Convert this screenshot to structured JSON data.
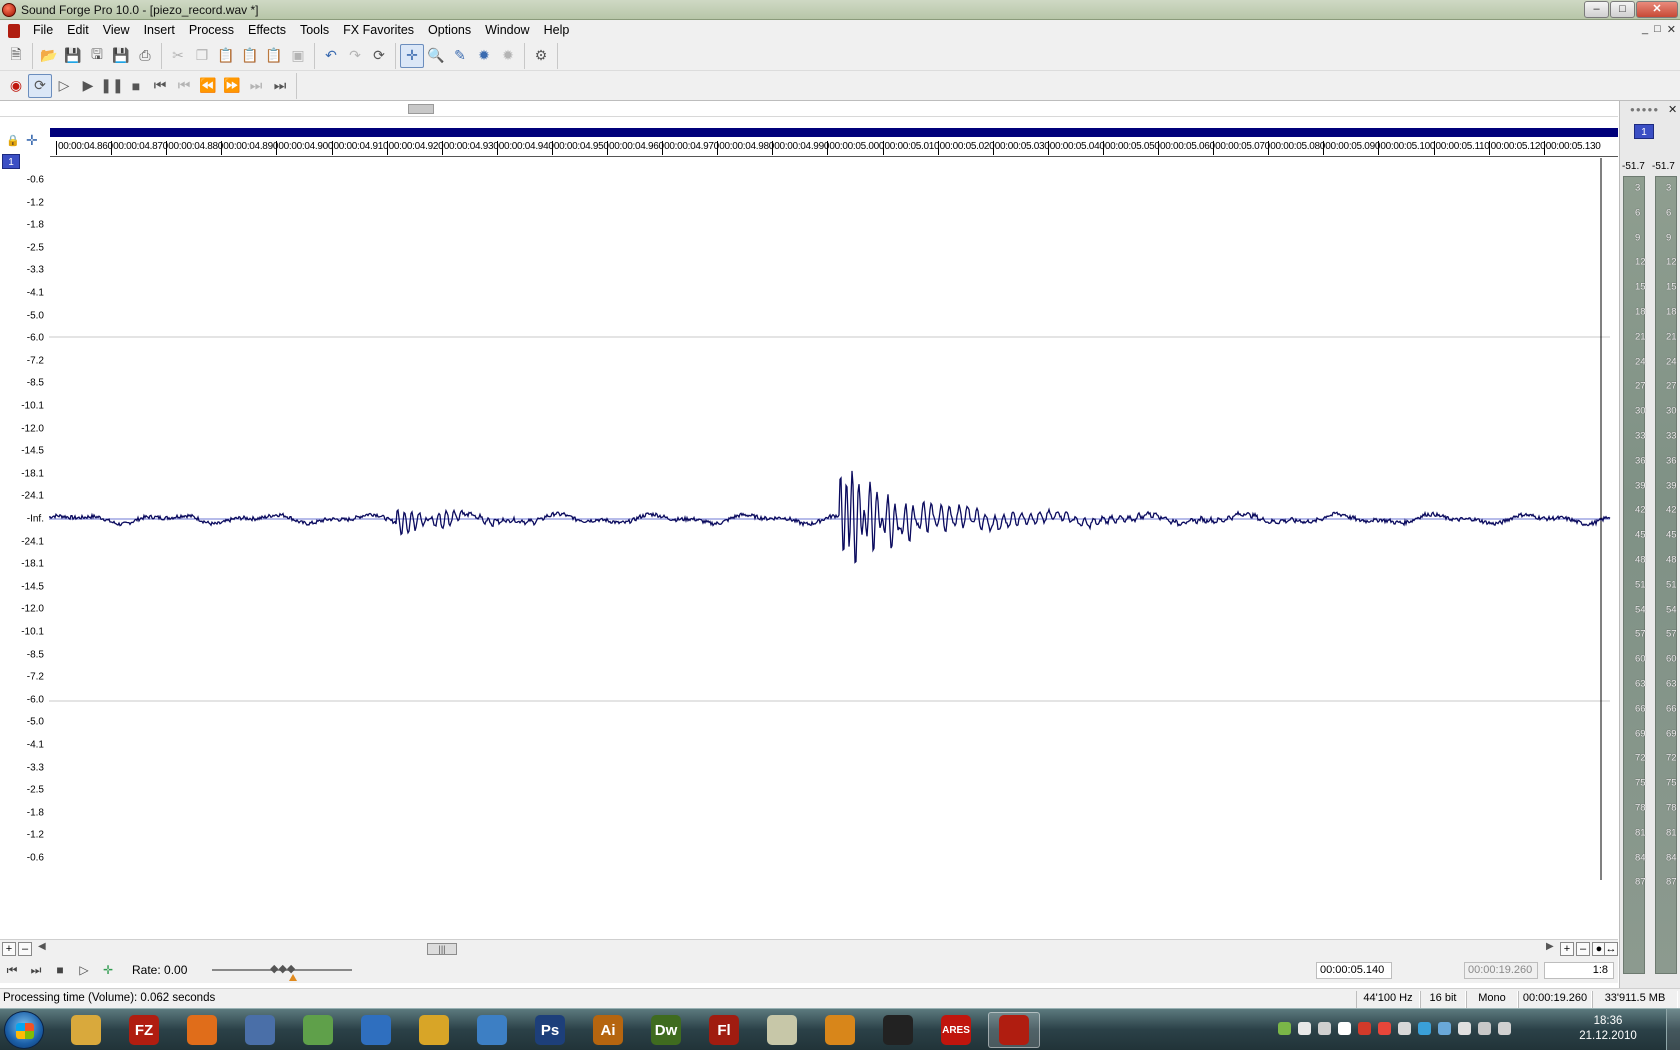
{
  "window": {
    "title": "Sound Forge Pro 10.0 - [piezo_record.wav *]",
    "controls": [
      "–",
      "□",
      "✕"
    ]
  },
  "menu": {
    "items": [
      "File",
      "Edit",
      "View",
      "Insert",
      "Process",
      "Effects",
      "Tools",
      "FX Favorites",
      "Options",
      "Window",
      "Help"
    ],
    "mdi_controls": [
      "_",
      "□",
      "✕"
    ]
  },
  "toolbar": {
    "icons": [
      "new-icon",
      "open-icon",
      "save-icon",
      "save-as-icon",
      "save-all-icon",
      "print-icon",
      "cut-icon",
      "copy-icon",
      "paste-icon",
      "mix-icon",
      "paste-special-icon",
      "crop-icon",
      "undo-icon",
      "redo-icon",
      "repeat-icon",
      "edit-tool-icon",
      "magnify-tool-icon",
      "pencil-tool-icon",
      "envelope-tool-icon",
      "event-tool-icon",
      "plugin-chainer-icon"
    ],
    "transport_icons": [
      "record-icon",
      "loop-icon",
      "play-all-icon",
      "play-icon",
      "pause-icon",
      "stop-icon",
      "go-to-start-icon",
      "previous-marker-icon",
      "rewind-icon",
      "forward-icon",
      "next-marker-icon",
      "go-to-end-icon"
    ]
  },
  "data_window": {
    "channel": "1",
    "ruler_labels": [
      "00:00:04.860",
      "00:00:04.870",
      "00:00:04.880",
      "00:00:04.890",
      "00:00:04.900",
      "00:00:04.910",
      "00:00:04.920",
      "00:00:04.930",
      "00:00:04.940",
      "00:00:04.950",
      "00:00:04.960",
      "00:00:04.970",
      "00:00:04.980",
      "00:00:04.990",
      "00:00:05.000",
      "00:00:05.010",
      "00:00:05.020",
      "00:00:05.030",
      "00:00:05.040",
      "00:00:05.050",
      "00:00:05.060",
      "00:00:05.070",
      "00:00:05.080",
      "00:00:05.090",
      "00:00:05.100",
      "00:00:05.110",
      "00:00:05.120",
      "00:00:05.130"
    ],
    "db_labels_top": [
      "-0.6",
      "-1.2",
      "-1.8",
      "-2.5",
      "-3.3",
      "-4.1",
      "-5.0",
      "-6.0",
      "-7.2",
      "-8.5",
      "-10.1",
      "-12.0",
      "-14.5",
      "-18.1",
      "-24.1"
    ],
    "db_center_label": "-Inf.",
    "db_labels_bottom": [
      "-24.1",
      "-18.1",
      "-14.5",
      "-12.0",
      "-10.1",
      "-8.5",
      "-7.2",
      "-6.0",
      "-5.0",
      "-4.1",
      "-3.3",
      "-2.5",
      "-1.8",
      "-1.2",
      "-0.6"
    ],
    "waveform_color": "#0b0b5e",
    "center_line_color": "#6f78d6"
  },
  "transport": {
    "rate_label": "Rate: 0.00",
    "time_position": "00:00:05.140",
    "selection_length": "00:00:19.260",
    "zoom_ratio": "1:8"
  },
  "status": {
    "message": "Processing time (Volume): 0.062 seconds",
    "sample_rate": "44'100 Hz",
    "bit_depth": "16 bit",
    "channels": "Mono",
    "length": "00:00:19.260",
    "disk_space": "33'911.5 MB"
  },
  "meters": {
    "channel": "1",
    "peak_left": "-51.7",
    "peak_right": "-51.7",
    "scale": [
      "3",
      "6",
      "9",
      "12",
      "15",
      "18",
      "21",
      "24",
      "27",
      "30",
      "33",
      "36",
      "39",
      "42",
      "45",
      "48",
      "51",
      "54",
      "57",
      "60",
      "63",
      "66",
      "69",
      "72",
      "75",
      "78",
      "81",
      "84",
      "87"
    ]
  },
  "taskbar": {
    "apps": [
      {
        "name": "explorer",
        "label": "",
        "color": "#d9a93c"
      },
      {
        "name": "filezilla",
        "label": "FZ",
        "color": "#b01d10"
      },
      {
        "name": "firefox",
        "label": "",
        "color": "#e06d1a"
      },
      {
        "name": "thunderbird",
        "label": "",
        "color": "#4a6fa8"
      },
      {
        "name": "app-green",
        "label": "",
        "color": "#5fa04a"
      },
      {
        "name": "app-globe",
        "label": "",
        "color": "#2f6fbf"
      },
      {
        "name": "chrome",
        "label": "",
        "color": "#d8a527"
      },
      {
        "name": "google-earth",
        "label": "",
        "color": "#3d7fc4"
      },
      {
        "name": "photoshop",
        "label": "Ps",
        "color": "#1d3f7a"
      },
      {
        "name": "illustrator",
        "label": "Ai",
        "color": "#b5650f"
      },
      {
        "name": "dreamweaver",
        "label": "Dw",
        "color": "#3f6b1f"
      },
      {
        "name": "flash",
        "label": "Fl",
        "color": "#a01c10"
      },
      {
        "name": "notepad",
        "label": "",
        "color": "#c7c7a8"
      },
      {
        "name": "media-player",
        "label": "",
        "color": "#d8861a"
      },
      {
        "name": "alienware",
        "label": "",
        "color": "#222222"
      },
      {
        "name": "ares",
        "label": "ARES",
        "color": "#c0150d"
      },
      {
        "name": "sound-forge",
        "label": "",
        "color": "#b01d10"
      }
    ],
    "time": "18:36",
    "date": "21.12.2010"
  }
}
